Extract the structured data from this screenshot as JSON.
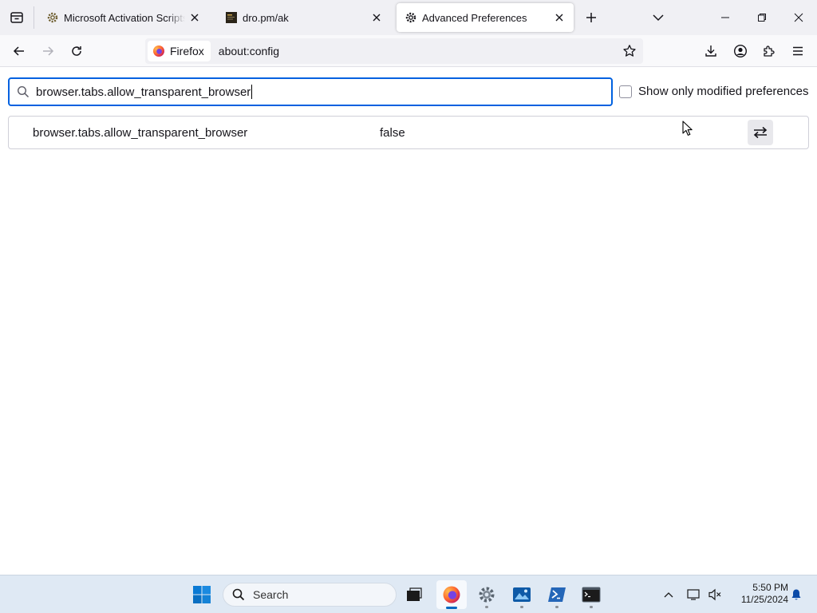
{
  "tabs": [
    {
      "title": "Microsoft Activation Scripts (MAS)",
      "icon": "gear-icon"
    },
    {
      "title": "dro.pm/ak",
      "icon": "page-favicon"
    },
    {
      "title": "Advanced Preferences",
      "icon": "gear-icon"
    }
  ],
  "navbar": {
    "identity_label": "Firefox",
    "url": "about:config"
  },
  "config": {
    "search_value": "browser.tabs.allow_transparent_browser",
    "modified_only_label": "Show only modified preferences",
    "modified_only_checked": false,
    "prefs": [
      {
        "name": "browser.tabs.allow_transparent_browser",
        "value": "false"
      }
    ]
  },
  "taskbar": {
    "search_placeholder": "Search",
    "time": "5:50 PM",
    "date": "11/25/2024"
  },
  "colors": {
    "accent": "#0061e0",
    "tabstrip": "#f0f0f4",
    "taskbar": "#dfe9f4"
  }
}
